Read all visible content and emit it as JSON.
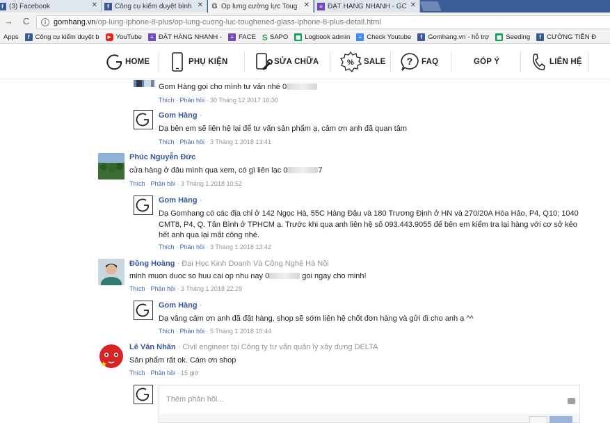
{
  "browser": {
    "tabs": [
      {
        "label": "(3) Facebook",
        "icon": "facebook-icon",
        "color": "#3b5998"
      },
      {
        "label": "Công cụ kiểm duyệt bình",
        "icon": "facebook-icon",
        "color": "#3b5998"
      },
      {
        "label": "Ốp lưng cường lực Toug",
        "icon": "gomhang-icon",
        "color": "#444444"
      },
      {
        "label": "ĐẶT HÀNG NHANH - GC",
        "icon": "form-icon",
        "color": "#7248b9"
      }
    ],
    "url_host": "gomhang.vn",
    "url_path": "/op-lung-iphone-8-plus/op-lung-cuong-luc-toughened-glass-iphone-8-plus-detail.html",
    "bookmarks_apps": "Apps",
    "bookmarks": [
      {
        "label": "Công cụ kiểm duyệt b",
        "icon": "facebook-icon",
        "color": "#3b5998"
      },
      {
        "label": "YouTube",
        "icon": "youtube-icon",
        "color": "#e62117"
      },
      {
        "label": "ĐẶT HÀNG NHANH -",
        "icon": "form-icon",
        "color": "#7248b9"
      },
      {
        "label": "FACE",
        "icon": "form-icon",
        "color": "#7248b9"
      },
      {
        "label": "SAPO",
        "icon": "sapo-icon",
        "color": "#2e9e4f"
      },
      {
        "label": "Logbook admin",
        "icon": "sheet-icon",
        "color": "#0f9d58"
      },
      {
        "label": "Check Youtube",
        "icon": "doc-icon",
        "color": "#4285f4"
      },
      {
        "label": "Gomhang.vn - hỗ trợ",
        "icon": "facebook-icon",
        "color": "#3b5998"
      },
      {
        "label": "Seeding",
        "icon": "sheet-icon",
        "color": "#0f9d58"
      },
      {
        "label": "CƯỜNG TIỀN Đ",
        "icon": "facebook-icon",
        "color": "#3b5998"
      }
    ]
  },
  "site_nav": {
    "home": "HOME",
    "accessories": "PHỤ KIỆN",
    "repair": "SỬA CHỮA",
    "sale": "SALE",
    "faq": "FAQ",
    "feedback": "GÓP Ý",
    "contact": "LIÊN HỆ",
    "sale_badge": "%"
  },
  "comments": {
    "c0": {
      "text": "Gom Hàng gọi cho mình tư vấn nhé 0",
      "text_tail": "",
      "like": "Thích",
      "reply": "Phản hồi",
      "time": "30 Tháng 12 2017 16:30"
    },
    "r0": {
      "name": "Gom Hàng",
      "text": "Dạ bên em sẽ liên hệ lại để tư vấn sản phẩm ạ, cảm ơn anh đã quan tâm",
      "like": "Thích",
      "reply": "Phản hồi",
      "time": "3 Tháng 1 2018 13:41"
    },
    "c1": {
      "name": "Phúc Nguyễn Đức",
      "text": "cửa hàng ở đâu mình qua xem, có gì liên lạc 0",
      "text_tail": "7",
      "like": "Thích",
      "reply": "Phản hồi",
      "time": "3 Tháng 1 2018 10:52"
    },
    "r1": {
      "name": "Gom Hàng",
      "text": "Dạ Gomhang có các địa chỉ ở 142 Ngọc Hà, 55C Hàng Đậu và 180 Trương Định ở HN và 270/20A Hòa Hảo, P4, Q10; 1040 CMT8, P4, Q. Tân Bình ở TPHCM ạ. Trước khi qua anh liên hệ số 093.443.9055 để bên em kiểm tra lại hàng với cơ sở kẻo hết anh qua lại mất công nhé.",
      "like": "Thích",
      "reply": "Phản hồi",
      "time": "3 Tháng 1 2018 13:42"
    },
    "c2": {
      "name": "Đồng Hoàng",
      "sub": "Đại Học Kinh Doanh Và Công Nghệ Hà Nội",
      "text": "minh muon duoc so huu cai op nhu nay 0",
      "text_tail": "goi ngay cho minh!",
      "like": "Thích",
      "reply": "Phản hồi",
      "time": "3 Tháng 1 2018 22:29"
    },
    "r2": {
      "name": "Gom Hàng",
      "text": "Dạ vâng cảm ơn anh đã đặt hàng, shop sẽ sớm liên hệ chốt đơn hàng và gửi đi cho anh ạ ^^",
      "like": "Thích",
      "reply": "Phản hồi",
      "time": "5 Tháng 1 2018 10:44"
    },
    "c3": {
      "name": "Lê Văn Nhân",
      "sub": "Civil engineer tại Công ty tư vấn quản lý xây dựng DELTA",
      "text": "Sản phẩm rất ok. Cám ơn shop",
      "like": "Thích",
      "reply": "Phản hồi",
      "time": "15 giờ"
    }
  },
  "reply_input": {
    "placeholder": "Thêm phản hồi..."
  }
}
